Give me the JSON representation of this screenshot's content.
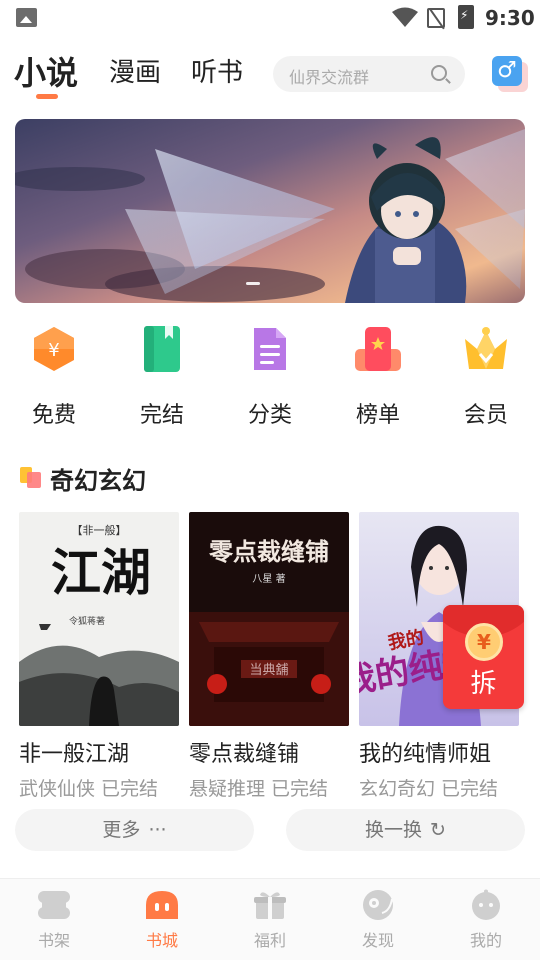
{
  "status_bar": {
    "time": "9:30"
  },
  "top_nav": {
    "tabs": [
      {
        "label": "小说",
        "active": true
      },
      {
        "label": "漫画",
        "active": false
      },
      {
        "label": "听书",
        "active": false
      }
    ],
    "search_placeholder": "仙界交流群",
    "gender_symbol": "♂"
  },
  "categories": [
    {
      "label": "免费",
      "icon": "coin-hexagon-icon"
    },
    {
      "label": "完结",
      "icon": "green-book-icon"
    },
    {
      "label": "分类",
      "icon": "document-icon"
    },
    {
      "label": "榜单",
      "icon": "ranking-badge-icon"
    },
    {
      "label": "会员",
      "icon": "crown-icon"
    }
  ],
  "section": {
    "title": "奇幻玄幻",
    "books": [
      {
        "title": "非一般江湖",
        "meta": "武侠仙侠 已完结",
        "cover_title": "江湖",
        "cover_tag": "【非一般】",
        "cover_author": "令狐蒋著"
      },
      {
        "title": "零点裁缝铺",
        "meta": "悬疑推理 已完结",
        "cover_title": "零点裁缝铺",
        "cover_author": "八星 著",
        "cover_sign": "当典舖"
      },
      {
        "title": "我的纯情师姐",
        "meta": "玄幻奇幻 已完结",
        "cover_title": "我的纯情"
      }
    ],
    "more_label": "更多",
    "more_symbol": "···",
    "refresh_label": "换一换",
    "refresh_symbol": "↻"
  },
  "red_envelope": {
    "coin": "¥",
    "label": "拆"
  },
  "bottom_nav": [
    {
      "label": "书架",
      "icon": "bookshelf-icon",
      "active": false
    },
    {
      "label": "书城",
      "icon": "bookstore-icon",
      "active": true
    },
    {
      "label": "福利",
      "icon": "gift-icon",
      "active": false
    },
    {
      "label": "发现",
      "icon": "discover-icon",
      "active": false
    },
    {
      "label": "我的",
      "icon": "profile-icon",
      "active": false
    }
  ],
  "colors": {
    "accent": "#ff7a45",
    "red_envelope": "#f43a3a",
    "gender": "#4aa3f0"
  }
}
